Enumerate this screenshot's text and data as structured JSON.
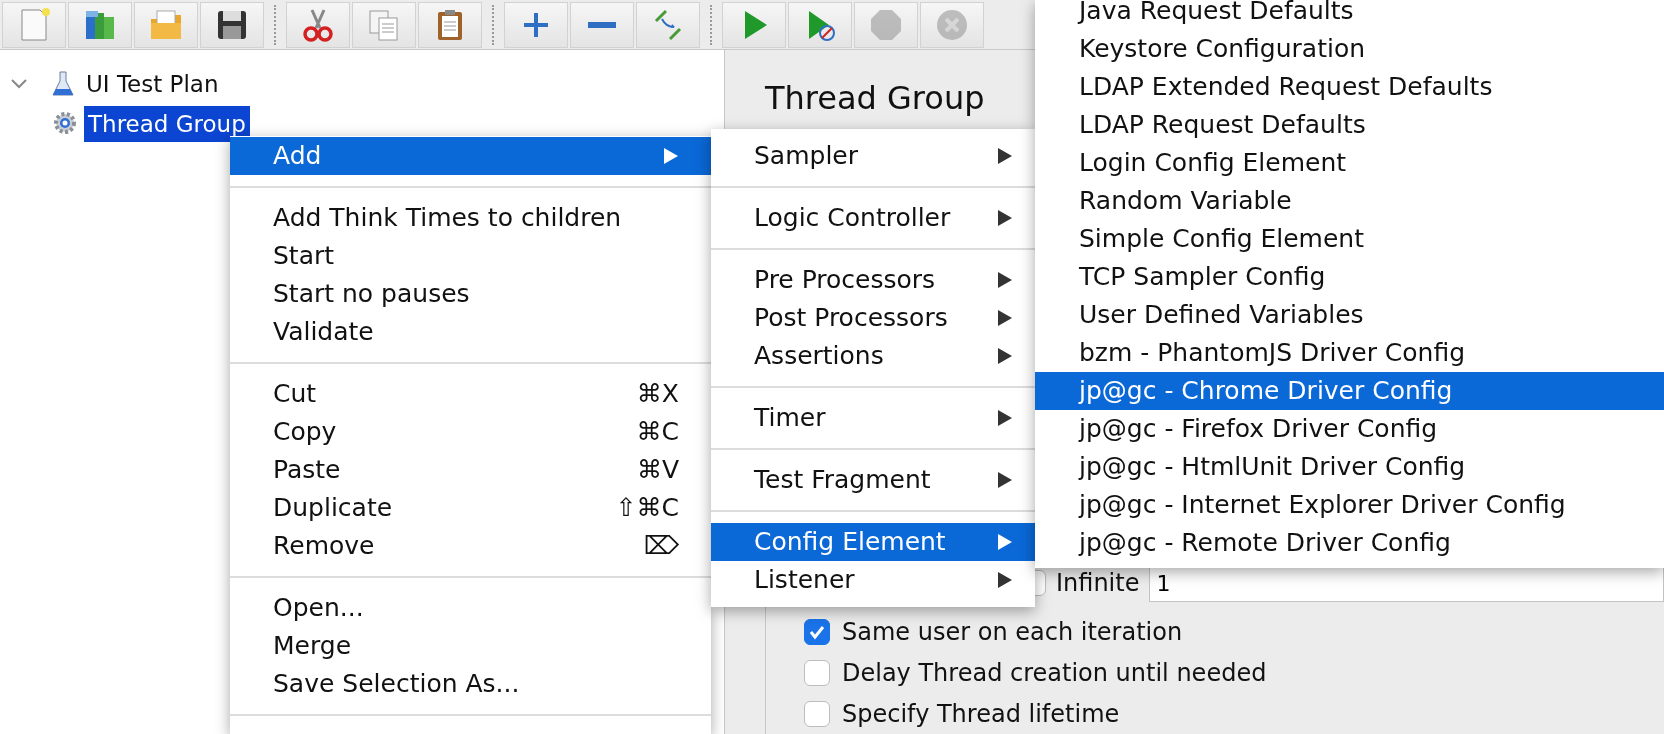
{
  "toolbar": {
    "groups": [
      [
        {
          "kind": "new",
          "disabled": false
        },
        {
          "kind": "templates",
          "disabled": false
        },
        {
          "kind": "open",
          "disabled": false
        },
        {
          "kind": "save",
          "disabled": false
        }
      ],
      [
        {
          "kind": "cut",
          "disabled": false
        },
        {
          "kind": "copy",
          "disabled": false
        },
        {
          "kind": "paste",
          "disabled": false
        }
      ],
      [
        {
          "kind": "expand",
          "disabled": false
        },
        {
          "kind": "collapse",
          "disabled": false
        },
        {
          "kind": "toggle",
          "disabled": false
        }
      ],
      [
        {
          "kind": "start",
          "disabled": false
        },
        {
          "kind": "start_no_pauses",
          "disabled": false
        },
        {
          "kind": "stop",
          "disabled": true
        },
        {
          "kind": "shutdown",
          "disabled": true
        }
      ]
    ]
  },
  "tree": {
    "items": [
      {
        "label": "UI Test Plan",
        "kind": "plan",
        "expanded": true,
        "selected": false,
        "children": [
          {
            "label": "Thread Group",
            "kind": "thread_group",
            "selected": true
          }
        ]
      }
    ]
  },
  "panel": {
    "title": "Thread Group",
    "loop": {
      "infinite_label": "Infinite",
      "infinite_checked": false,
      "value": "1"
    },
    "options": [
      {
        "label": "Same user on each iteration",
        "checked": true
      },
      {
        "label": "Delay Thread creation until needed",
        "checked": false
      },
      {
        "label": "Specify Thread lifetime",
        "checked": false
      }
    ]
  },
  "context_menu": {
    "sections": [
      [
        {
          "label": "Add",
          "submenu": true,
          "selected": true
        }
      ],
      [
        {
          "label": "Add Think Times to children"
        },
        {
          "label": "Start"
        },
        {
          "label": "Start no pauses"
        },
        {
          "label": "Validate"
        }
      ],
      [
        {
          "label": "Cut",
          "shortcut": "⌘X"
        },
        {
          "label": "Copy",
          "shortcut": "⌘C"
        },
        {
          "label": "Paste",
          "shortcut": "⌘V"
        },
        {
          "label": "Duplicate",
          "shortcut": "⇧⌘C"
        },
        {
          "label": "Remove",
          "shortcut": "⌦"
        }
      ],
      [
        {
          "label": "Open..."
        },
        {
          "label": "Merge"
        },
        {
          "label": "Save Selection As..."
        }
      ]
    ]
  },
  "add_submenu": {
    "sections": [
      [
        {
          "label": "Sampler",
          "submenu": true,
          "selected": false
        }
      ],
      [
        {
          "label": "Logic Controller",
          "submenu": true,
          "selected": false
        }
      ],
      [
        {
          "label": "Pre Processors",
          "submenu": true,
          "selected": false
        },
        {
          "label": "Post Processors",
          "submenu": true,
          "selected": false
        },
        {
          "label": "Assertions",
          "submenu": true,
          "selected": false
        }
      ],
      [
        {
          "label": "Timer",
          "submenu": true,
          "selected": false
        }
      ],
      [
        {
          "label": "Test Fragment",
          "submenu": true,
          "selected": false
        }
      ],
      [
        {
          "label": "Config Element",
          "submenu": true,
          "selected": true
        },
        {
          "label": "Listener",
          "submenu": true,
          "selected": false
        }
      ]
    ]
  },
  "config_submenu": {
    "items": [
      {
        "label": "Java Request Defaults",
        "selected": false
      },
      {
        "label": "Keystore Configuration",
        "selected": false
      },
      {
        "label": "LDAP Extended Request Defaults",
        "selected": false
      },
      {
        "label": "LDAP Request Defaults",
        "selected": false
      },
      {
        "label": "Login Config Element",
        "selected": false
      },
      {
        "label": "Random Variable",
        "selected": false
      },
      {
        "label": "Simple Config Element",
        "selected": false
      },
      {
        "label": "TCP Sampler Config",
        "selected": false
      },
      {
        "label": "User Defined Variables",
        "selected": false
      },
      {
        "label": "bzm - PhantomJS Driver Config",
        "selected": false
      },
      {
        "label": "jp@gc - Chrome Driver Config",
        "selected": true
      },
      {
        "label": "jp@gc - Firefox Driver Config",
        "selected": false
      },
      {
        "label": "jp@gc - HtmlUnit Driver Config",
        "selected": false
      },
      {
        "label": "jp@gc - Internet Explorer Driver Config",
        "selected": false
      },
      {
        "label": "jp@gc - Remote Driver Config",
        "selected": false
      }
    ]
  }
}
